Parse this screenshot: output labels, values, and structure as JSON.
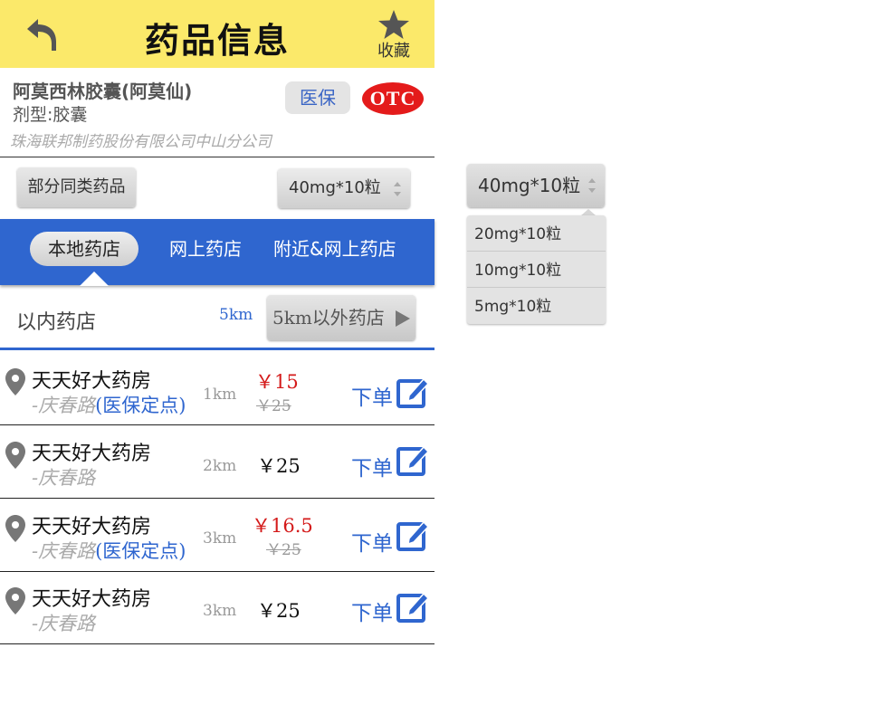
{
  "header": {
    "title": "药品信息",
    "fav_label": "收藏"
  },
  "drug": {
    "name": "阿莫西林胶囊(阿莫仙)",
    "form": "剂型:胶囊",
    "maker": "珠海联邦制药股份有限公司中山分公司",
    "insurance_badge": "医保",
    "otc_badge": "OTC"
  },
  "filters": {
    "similar_label": "部分同类药品",
    "spec_value": "40mg*10粒"
  },
  "tabs": [
    {
      "label": "本地药店",
      "active": true
    },
    {
      "label": "网上药店",
      "active": false
    },
    {
      "label": "附近&网上药店",
      "active": false
    }
  ],
  "distance": {
    "within_km": "5km",
    "within_text": "以内药店",
    "outside_label": "5km以外药店"
  },
  "stores": [
    {
      "name": "天天好大药房",
      "street": "-庆春路",
      "tag": "(医保定点)",
      "km": "1km",
      "price": "￥15",
      "old_price": "￥25",
      "order": "下单"
    },
    {
      "name": "天天好大药房",
      "street": "-庆春路",
      "tag": "",
      "km": "2km",
      "price": "￥25",
      "old_price": "",
      "order": "下单"
    },
    {
      "name": "天天好大药房",
      "street": "-庆春路",
      "tag": "(医保定点)",
      "km": "3km",
      "price": "￥16.5",
      "old_price": "￥25",
      "order": "下单"
    },
    {
      "name": "天天好大药房",
      "street": "-庆春路",
      "tag": "",
      "km": "3km",
      "price": "￥25",
      "old_price": "",
      "order": "下单"
    }
  ],
  "dropdown": {
    "selected": "40mg*10粒",
    "options": [
      "20mg*10粒",
      "10mg*10粒",
      "5mg*10粒"
    ]
  },
  "colors": {
    "header_bg": "#fbe96a",
    "accent_blue": "#2f66cf",
    "price_red": "#d41a1a",
    "otc_red": "#e41b1b"
  }
}
